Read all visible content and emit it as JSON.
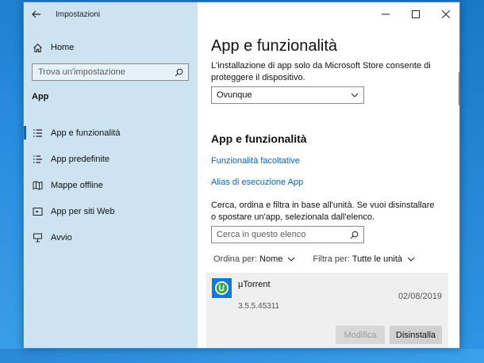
{
  "window": {
    "app_title": "Impostazioni",
    "back_icon": "back-arrow-icon",
    "controls": {
      "minimize": "—",
      "maximize": "☐",
      "close": "✕"
    }
  },
  "sidebar": {
    "home_label": "Home",
    "search_placeholder": "Trova un'impostazione",
    "section_heading": "App",
    "items": [
      {
        "label": "App e funzionalità",
        "icon": "list-icon",
        "active": true
      },
      {
        "label": "App predefinite",
        "icon": "list-default-icon",
        "active": false
      },
      {
        "label": "Mappe offline",
        "icon": "map-icon",
        "active": false
      },
      {
        "label": "App per siti Web",
        "icon": "web-app-icon",
        "active": false
      },
      {
        "label": "Avvio",
        "icon": "startup-icon",
        "active": false
      }
    ]
  },
  "main": {
    "title": "App e funzionalità",
    "install_description": "L'installazione di app solo da Microsoft Store consente di proteggere il dispositivo.",
    "install_source_value": "Ovunque",
    "subheading": "App e funzionalità",
    "links": {
      "optional_features": "Funzionalità facoltative",
      "app_execution_aliases": "Alias di esecuzione App"
    },
    "list_description": "Cerca, ordina e filtra in base all'unità. Se vuoi disinstallare o spostare un'app, selezionala dall'elenco.",
    "list_search_placeholder": "Cerca in questo elenco",
    "sort": {
      "label": "Ordina per:",
      "value": "Nome"
    },
    "filter": {
      "label": "Filtra per:",
      "value": "Tutte le unità"
    },
    "app": {
      "name": "µTorrent",
      "date": "02/08/2019",
      "version": "3.5.5.45311",
      "modify_label": "Modifica",
      "uninstall_label": "Disinstalla"
    }
  },
  "colors": {
    "sidebar_bg": "#cde3f2",
    "link": "#0a62b5",
    "accent": "#1a5fa8",
    "app_icon_bg": "#0c7bd8"
  }
}
